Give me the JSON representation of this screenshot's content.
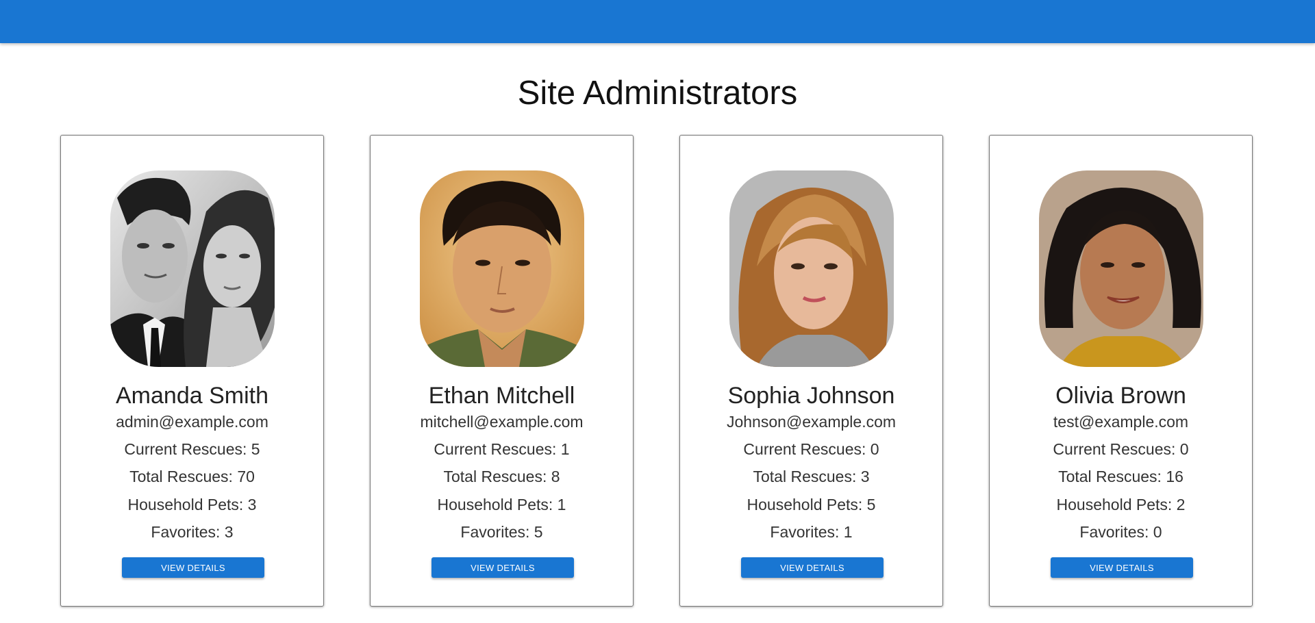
{
  "page": {
    "title": "Site Administrators"
  },
  "colors": {
    "appbar": "#1976d2",
    "button": "#1976d2"
  },
  "admins": [
    {
      "name": "Amanda Smith",
      "email": "admin@example.com",
      "current_rescues": "Current Rescues: 5",
      "total_rescues": "Total Rescues: 70",
      "household_pets": "Household Pets: 3",
      "favorites": "Favorites: 3",
      "button_label": "VIEW DETAILS"
    },
    {
      "name": "Ethan Mitchell",
      "email": "mitchell@example.com",
      "current_rescues": "Current Rescues: 1",
      "total_rescues": "Total Rescues: 8",
      "household_pets": "Household Pets: 1",
      "favorites": "Favorites: 5",
      "button_label": "VIEW DETAILS"
    },
    {
      "name": "Sophia Johnson",
      "email": "Johnson@example.com",
      "current_rescues": "Current Rescues: 0",
      "total_rescues": "Total Rescues: 3",
      "household_pets": "Household Pets: 5",
      "favorites": "Favorites: 1",
      "button_label": "VIEW DETAILS"
    },
    {
      "name": "Olivia Brown",
      "email": "test@example.com",
      "current_rescues": "Current Rescues: 0",
      "total_rescues": "Total Rescues: 16",
      "household_pets": "Household Pets: 2",
      "favorites": "Favorites: 0",
      "button_label": "VIEW DETAILS"
    }
  ]
}
